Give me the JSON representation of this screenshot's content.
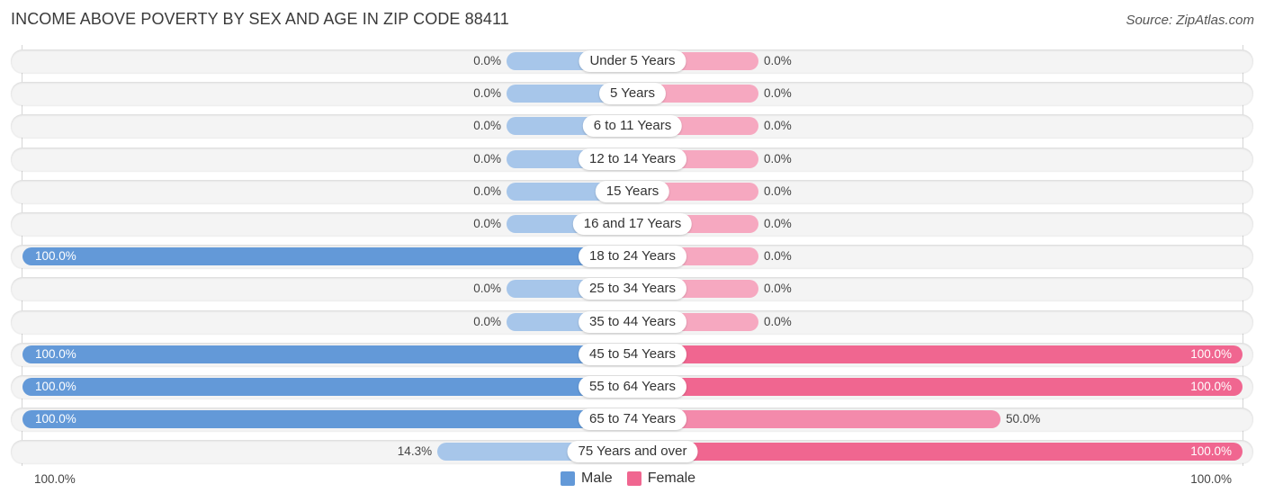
{
  "title": "INCOME ABOVE POVERTY BY SEX AND AGE IN ZIP CODE 88411",
  "source": "Source: ZipAtlas.com",
  "colors": {
    "male": "#6399d8",
    "male_light": "#a7c6ea",
    "female": "#f06690",
    "female_light": "#f6a8c0"
  },
  "chart_data": {
    "type": "bar",
    "orientation": "horizontal-diverging",
    "title": "INCOME ABOVE POVERTY BY SEX AND AGE IN ZIP CODE 88411",
    "categories": [
      "Under 5 Years",
      "5 Years",
      "6 to 11 Years",
      "12 to 14 Years",
      "15 Years",
      "16 and 17 Years",
      "18 to 24 Years",
      "25 to 34 Years",
      "35 to 44 Years",
      "45 to 54 Years",
      "55 to 64 Years",
      "65 to 74 Years",
      "75 Years and over"
    ],
    "series": [
      {
        "name": "Male",
        "values": [
          0,
          0,
          0,
          0,
          0,
          0,
          100,
          0,
          0,
          100,
          100,
          100,
          14.3
        ]
      },
      {
        "name": "Female",
        "values": [
          0,
          0,
          0,
          0,
          0,
          0,
          0,
          0,
          0,
          100,
          100,
          50,
          100
        ]
      }
    ],
    "value_labels": {
      "Male": [
        "0.0%",
        "0.0%",
        "0.0%",
        "0.0%",
        "0.0%",
        "0.0%",
        "100.0%",
        "0.0%",
        "0.0%",
        "100.0%",
        "100.0%",
        "100.0%",
        "14.3%"
      ],
      "Female": [
        "0.0%",
        "0.0%",
        "0.0%",
        "0.0%",
        "0.0%",
        "0.0%",
        "0.0%",
        "0.0%",
        "0.0%",
        "100.0%",
        "100.0%",
        "50.0%",
        "100.0%"
      ]
    },
    "axis": {
      "left_label": "100.0%",
      "right_label": "100.0%",
      "range": [
        0,
        100
      ],
      "unit": "%"
    },
    "legend": {
      "position": "bottom-center",
      "items": [
        "Male",
        "Female"
      ]
    },
    "xlabel": "",
    "ylabel": ""
  }
}
